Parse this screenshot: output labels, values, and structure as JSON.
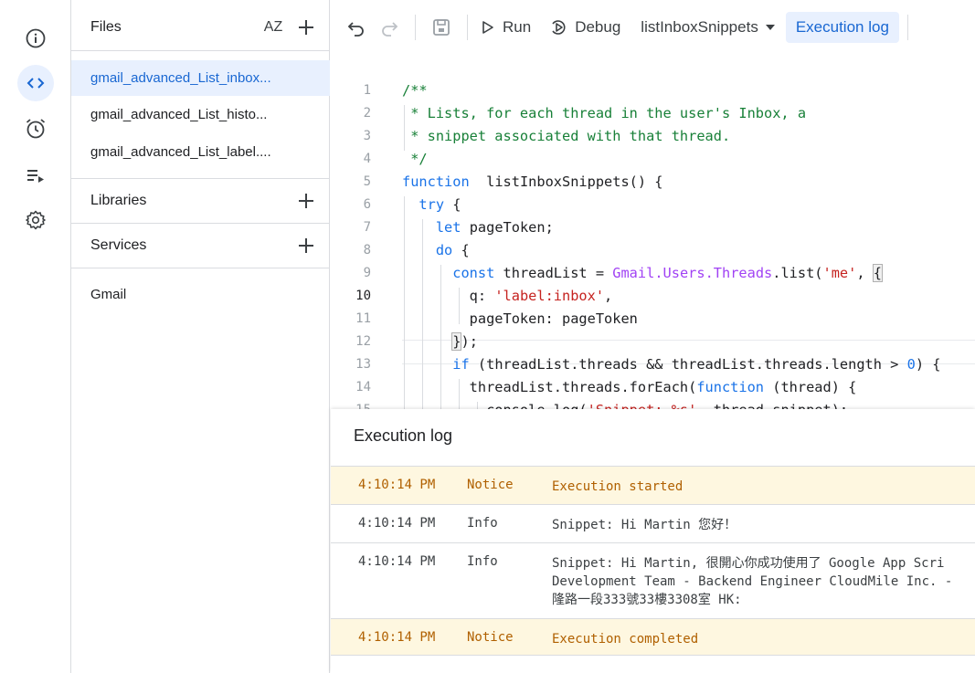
{
  "rail": {
    "items": [
      {
        "name": "overview",
        "active": false
      },
      {
        "name": "editor",
        "active": true
      },
      {
        "name": "triggers",
        "active": false
      },
      {
        "name": "executions",
        "active": false
      },
      {
        "name": "settings",
        "active": false
      }
    ]
  },
  "files_panel": {
    "title": "Files",
    "sort_label": "AZ",
    "files": [
      "gmail_advanced_List_inbox...",
      "gmail_advanced_List_histo...",
      "gmail_advanced_List_label...."
    ],
    "active_file": 0,
    "libraries_label": "Libraries",
    "services_label": "Services",
    "services": [
      "Gmail"
    ]
  },
  "toolbar": {
    "run_label": "Run",
    "debug_label": "Debug",
    "function_name": "listInboxSnippets",
    "exec_log_label": "Execution log"
  },
  "editor": {
    "line_numbers": [
      "1",
      "2",
      "3",
      "4",
      "5",
      "6",
      "7",
      "8",
      "9",
      "10",
      "11",
      "12",
      "13",
      "14",
      "15"
    ],
    "current_line": "10",
    "lines": [
      [
        [
          "c-com",
          "/**"
        ]
      ],
      [
        [
          "c-com",
          " * Lists, for each thread in the user's Inbox, a"
        ]
      ],
      [
        [
          "c-com",
          " * snippet associated with that thread."
        ]
      ],
      [
        [
          "c-com",
          " */"
        ]
      ],
      [
        [
          "c-kw",
          "function"
        ],
        [
          "",
          "  listInboxSnippets() {"
        ]
      ],
      [
        [
          "",
          "  "
        ],
        [
          "c-kw",
          "try"
        ],
        [
          "",
          " {"
        ]
      ],
      [
        [
          "",
          "    "
        ],
        [
          "c-kw",
          "let"
        ],
        [
          "",
          " pageToken;"
        ]
      ],
      [
        [
          "",
          "    "
        ],
        [
          "c-kw",
          "do"
        ],
        [
          "",
          " {"
        ]
      ],
      [
        [
          "",
          "      "
        ],
        [
          "c-kw",
          "const"
        ],
        [
          "",
          " threadList = "
        ],
        [
          "c-prop",
          "Gmail.Users.Threads"
        ],
        [
          "",
          ".list("
        ],
        [
          "c-str",
          "'me'"
        ],
        [
          "",
          ", "
        ],
        [
          "bracket-hl",
          "{"
        ]
      ],
      [
        [
          "",
          "        q: "
        ],
        [
          "c-str",
          "'label:inbox'"
        ],
        [
          "",
          ","
        ]
      ],
      [
        [
          "",
          "        pageToken: pageToken"
        ]
      ],
      [
        [
          "",
          "      "
        ],
        [
          "bracket-hl",
          "}"
        ],
        [
          "",
          ");"
        ]
      ],
      [
        [
          "",
          "      "
        ],
        [
          "c-kw",
          "if"
        ],
        [
          "",
          " (threadList.threads && threadList.threads.length > "
        ],
        [
          "c-num",
          "0"
        ],
        [
          "",
          ") {"
        ]
      ],
      [
        [
          "",
          "        threadList.threads.forEach("
        ],
        [
          "c-kw",
          "function"
        ],
        [
          "",
          " (thread) {"
        ]
      ],
      [
        [
          "",
          "          console.log("
        ],
        [
          "c-str",
          "'Snippet: %s'"
        ],
        [
          "",
          ", thread.snippet);"
        ]
      ]
    ]
  },
  "log": {
    "title": "Execution log",
    "rows": [
      {
        "time": "4:10:14 PM",
        "severity": "Notice",
        "message": [
          "Execution started"
        ],
        "notice": true
      },
      {
        "time": "4:10:14 PM",
        "severity": "Info",
        "message": [
          "Snippet: Hi Martin 您好！"
        ],
        "notice": false
      },
      {
        "time": "4:10:14 PM",
        "severity": "Info",
        "message": [
          "Snippet: Hi Martin, 很開心你成功使用了 Google App Scri",
          "Development Team - Backend Engineer CloudMile Inc. -",
          "隆路一段333號33樓3308室 HK:"
        ],
        "notice": false
      },
      {
        "time": "4:10:14 PM",
        "severity": "Notice",
        "message": [
          "Execution completed"
        ],
        "notice": true
      }
    ]
  },
  "colors": {
    "accent": "#1967d2",
    "active_bg": "#e8f0fe",
    "notice_bg": "#fef7e0",
    "comment": "#188038",
    "keyword": "#1a73e8",
    "string": "#c5221f"
  }
}
